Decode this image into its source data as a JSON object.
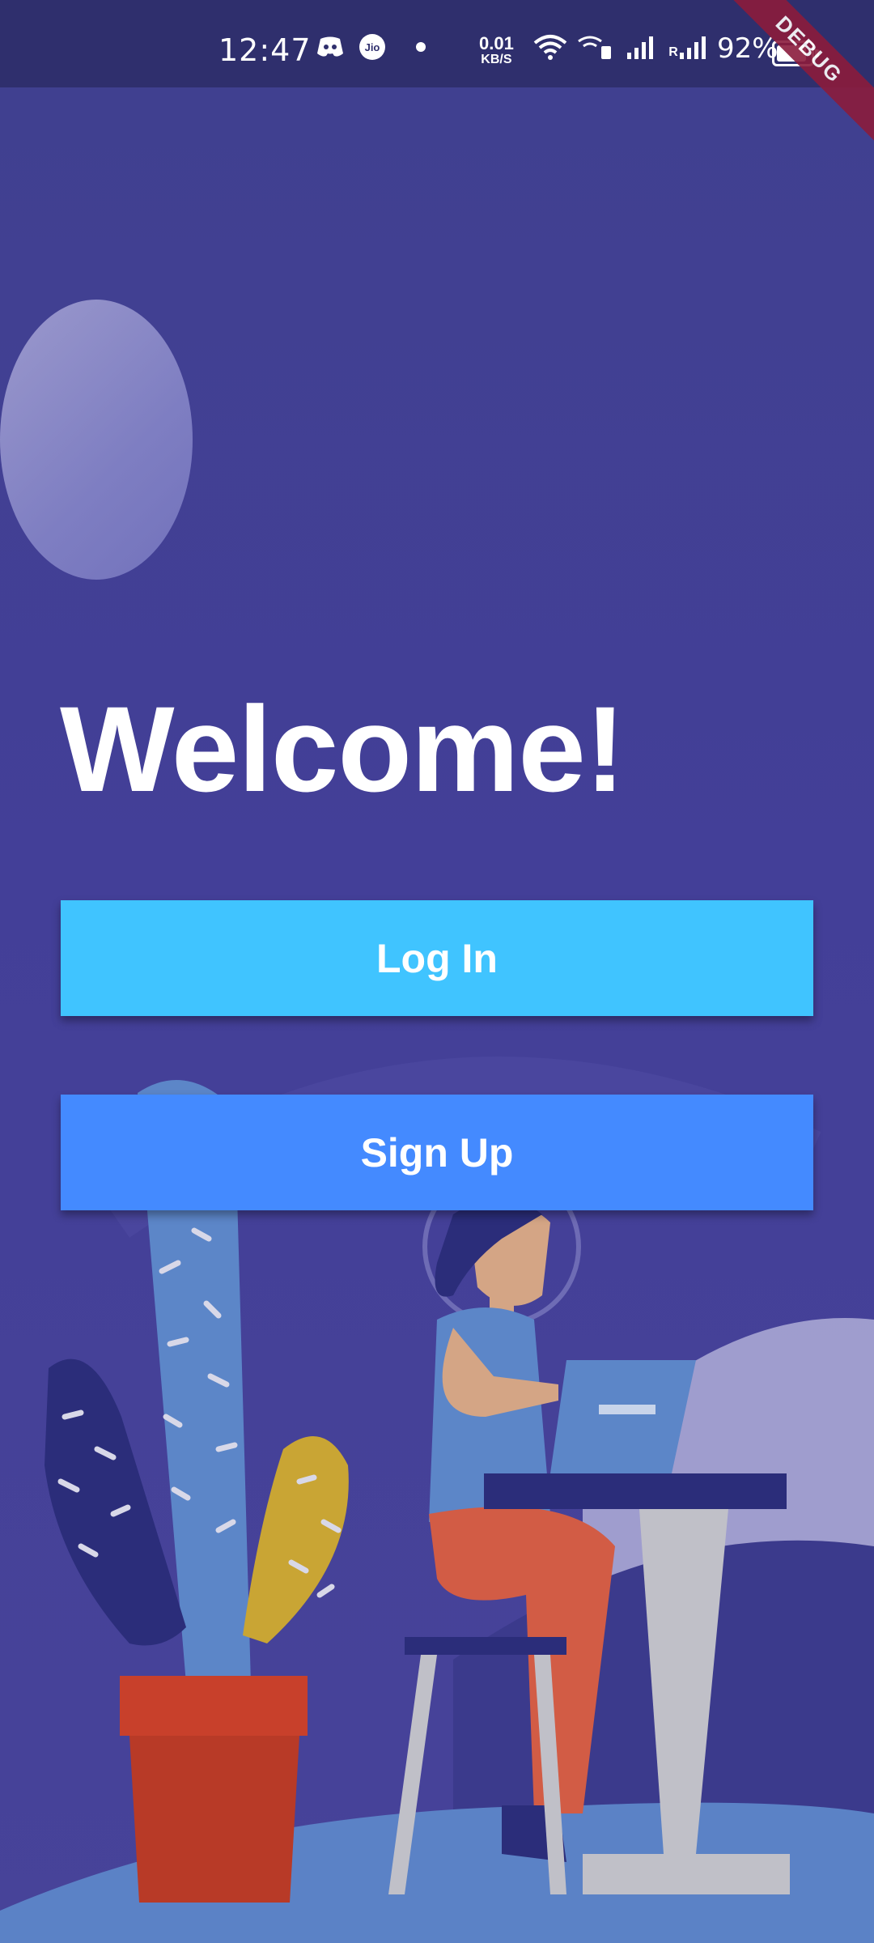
{
  "status_bar": {
    "time": "12:47",
    "net_speed_value": "0.01",
    "net_speed_unit": "KB/S",
    "roaming_label": "R",
    "battery": "92%",
    "icons": [
      "discord-icon",
      "jio-icon",
      "dot-icon",
      "wifi-icon",
      "wifi-calling-icon",
      "signal-icon",
      "signal-roaming-icon",
      "battery-icon"
    ]
  },
  "debug_banner": "DEBUG",
  "jio_label": "Jio",
  "main": {
    "title": "Welcome!",
    "login_label": "Log In",
    "signup_label": "Sign Up"
  },
  "colors": {
    "background": "#413f96",
    "status_bar": "#2f2f6d",
    "login_button": "#40c4ff",
    "signup_button": "#448aff",
    "debug_banner": "#8b1c3c"
  }
}
